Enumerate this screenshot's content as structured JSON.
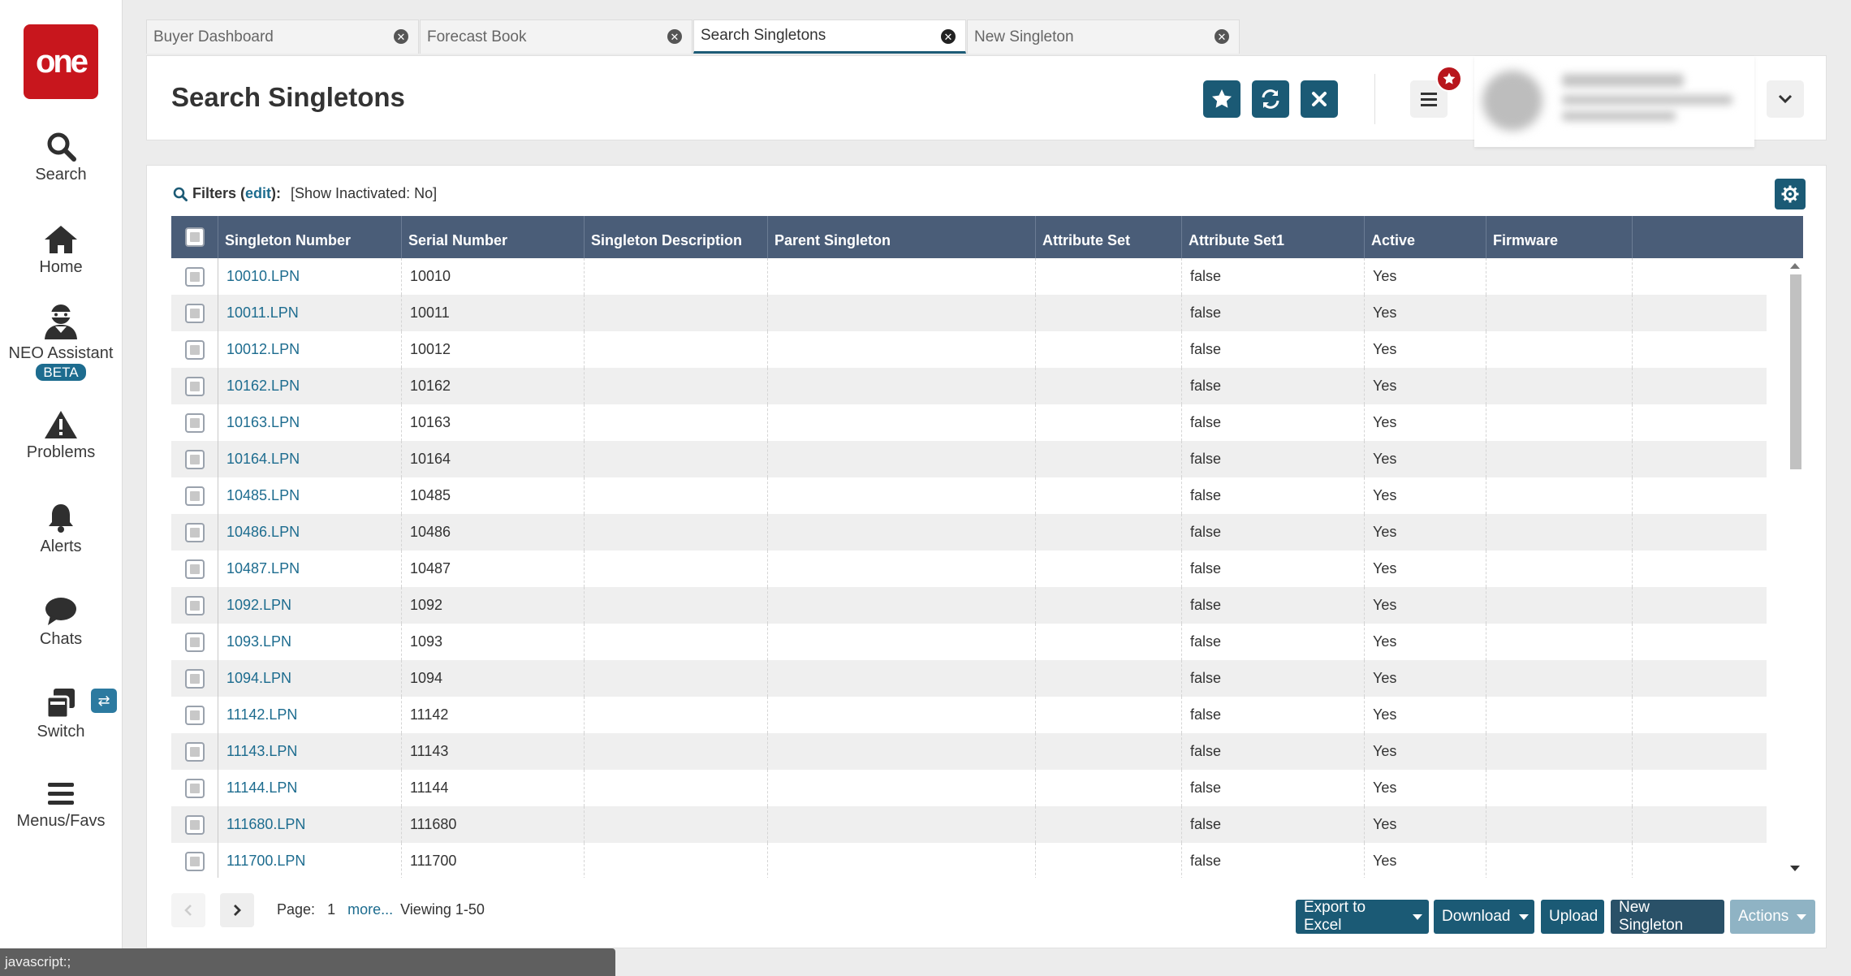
{
  "app": {
    "logo_text": "one",
    "brand_color": "#c8161d",
    "accent_color": "#1b5a75"
  },
  "nav": {
    "search": "Search",
    "home": "Home",
    "neo": "NEO Assistant",
    "beta": "BETA",
    "problems": "Problems",
    "alerts": "Alerts",
    "chats": "Chats",
    "switch": "Switch",
    "menus": "Menus/Favs"
  },
  "tabs": [
    {
      "label": "Buyer Dashboard"
    },
    {
      "label": "Forecast Book"
    },
    {
      "label": "Search Singletons"
    },
    {
      "label": "New Singleton"
    }
  ],
  "header": {
    "title": "Search Singletons"
  },
  "filters": {
    "label": "Filters (",
    "edit": "edit",
    "suffix": "):",
    "value": "[Show Inactivated: No]"
  },
  "table": {
    "columns": [
      "Singleton Number",
      "Serial Number",
      "Singleton Description",
      "Parent Singleton",
      "Attribute Set",
      "Attribute Set1",
      "Active",
      "Firmware"
    ],
    "rows": [
      {
        "number": "10010.LPN",
        "serial": "10010",
        "set1": "false",
        "active": "Yes"
      },
      {
        "number": "10011.LPN",
        "serial": "10011",
        "set1": "false",
        "active": "Yes"
      },
      {
        "number": "10012.LPN",
        "serial": "10012",
        "set1": "false",
        "active": "Yes"
      },
      {
        "number": "10162.LPN",
        "serial": "10162",
        "set1": "false",
        "active": "Yes"
      },
      {
        "number": "10163.LPN",
        "serial": "10163",
        "set1": "false",
        "active": "Yes"
      },
      {
        "number": "10164.LPN",
        "serial": "10164",
        "set1": "false",
        "active": "Yes"
      },
      {
        "number": "10485.LPN",
        "serial": "10485",
        "set1": "false",
        "active": "Yes"
      },
      {
        "number": "10486.LPN",
        "serial": "10486",
        "set1": "false",
        "active": "Yes"
      },
      {
        "number": "10487.LPN",
        "serial": "10487",
        "set1": "false",
        "active": "Yes"
      },
      {
        "number": "1092.LPN",
        "serial": "1092",
        "set1": "false",
        "active": "Yes"
      },
      {
        "number": "1093.LPN",
        "serial": "1093",
        "set1": "false",
        "active": "Yes"
      },
      {
        "number": "1094.LPN",
        "serial": "1094",
        "set1": "false",
        "active": "Yes"
      },
      {
        "number": "11142.LPN",
        "serial": "11142",
        "set1": "false",
        "active": "Yes"
      },
      {
        "number": "11143.LPN",
        "serial": "11143",
        "set1": "false",
        "active": "Yes"
      },
      {
        "number": "11144.LPN",
        "serial": "11144",
        "set1": "false",
        "active": "Yes"
      },
      {
        "number": "111680.LPN",
        "serial": "111680",
        "set1": "false",
        "active": "Yes"
      },
      {
        "number": "111700.LPN",
        "serial": "111700",
        "set1": "false",
        "active": "Yes"
      }
    ]
  },
  "pagination": {
    "page_label": "Page:",
    "page": "1",
    "more": "more...",
    "viewing": "Viewing 1-50"
  },
  "footer": {
    "export": "Export to Excel",
    "download": "Download",
    "upload": "Upload",
    "new_singleton": "New Singleton",
    "actions": "Actions"
  },
  "status_bar": "javascript:;"
}
